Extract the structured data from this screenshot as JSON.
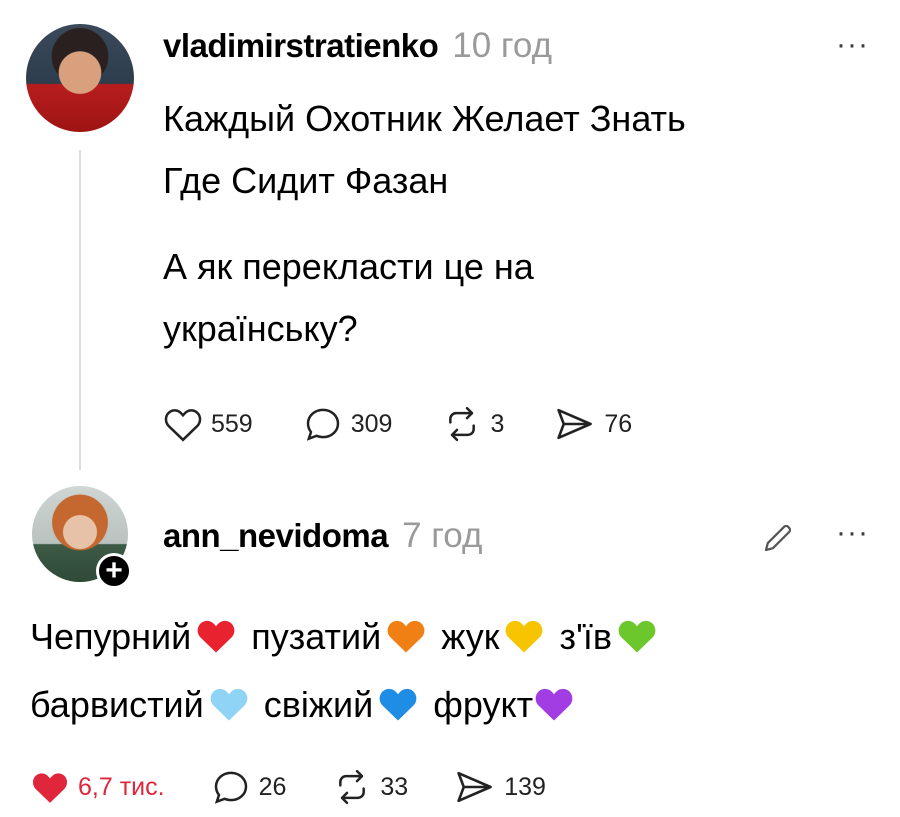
{
  "post1": {
    "username": "vladimirstratienko",
    "time": "10 год",
    "more_icon": "ellipsis-icon",
    "line1": "Каждый Охотник Желает Знать",
    "line2": "Где Сидит Фазан",
    "line3": "А як перекласти це на",
    "line4": "українську?",
    "likes": "559",
    "comments": "309",
    "reposts": "3",
    "shares": "76"
  },
  "post2": {
    "username": "ann_nevidoma",
    "time": "7 год",
    "edit_icon": "pencil-icon",
    "more_icon": "ellipsis-icon",
    "words": [
      "Чепурний",
      "пузатий",
      "жук",
      "з'їв",
      "барвистий",
      "свіжий",
      "фрукт"
    ],
    "hearts": [
      "#e8222e",
      "#f07f14",
      "#f7c500",
      "#6cc72d",
      "#8fd4f5",
      "#1f8de6",
      "#a13de3"
    ],
    "likes": "6,7 тис.",
    "comments": "26",
    "reposts": "33",
    "shares": "139",
    "liked_color": "#e0263a"
  }
}
